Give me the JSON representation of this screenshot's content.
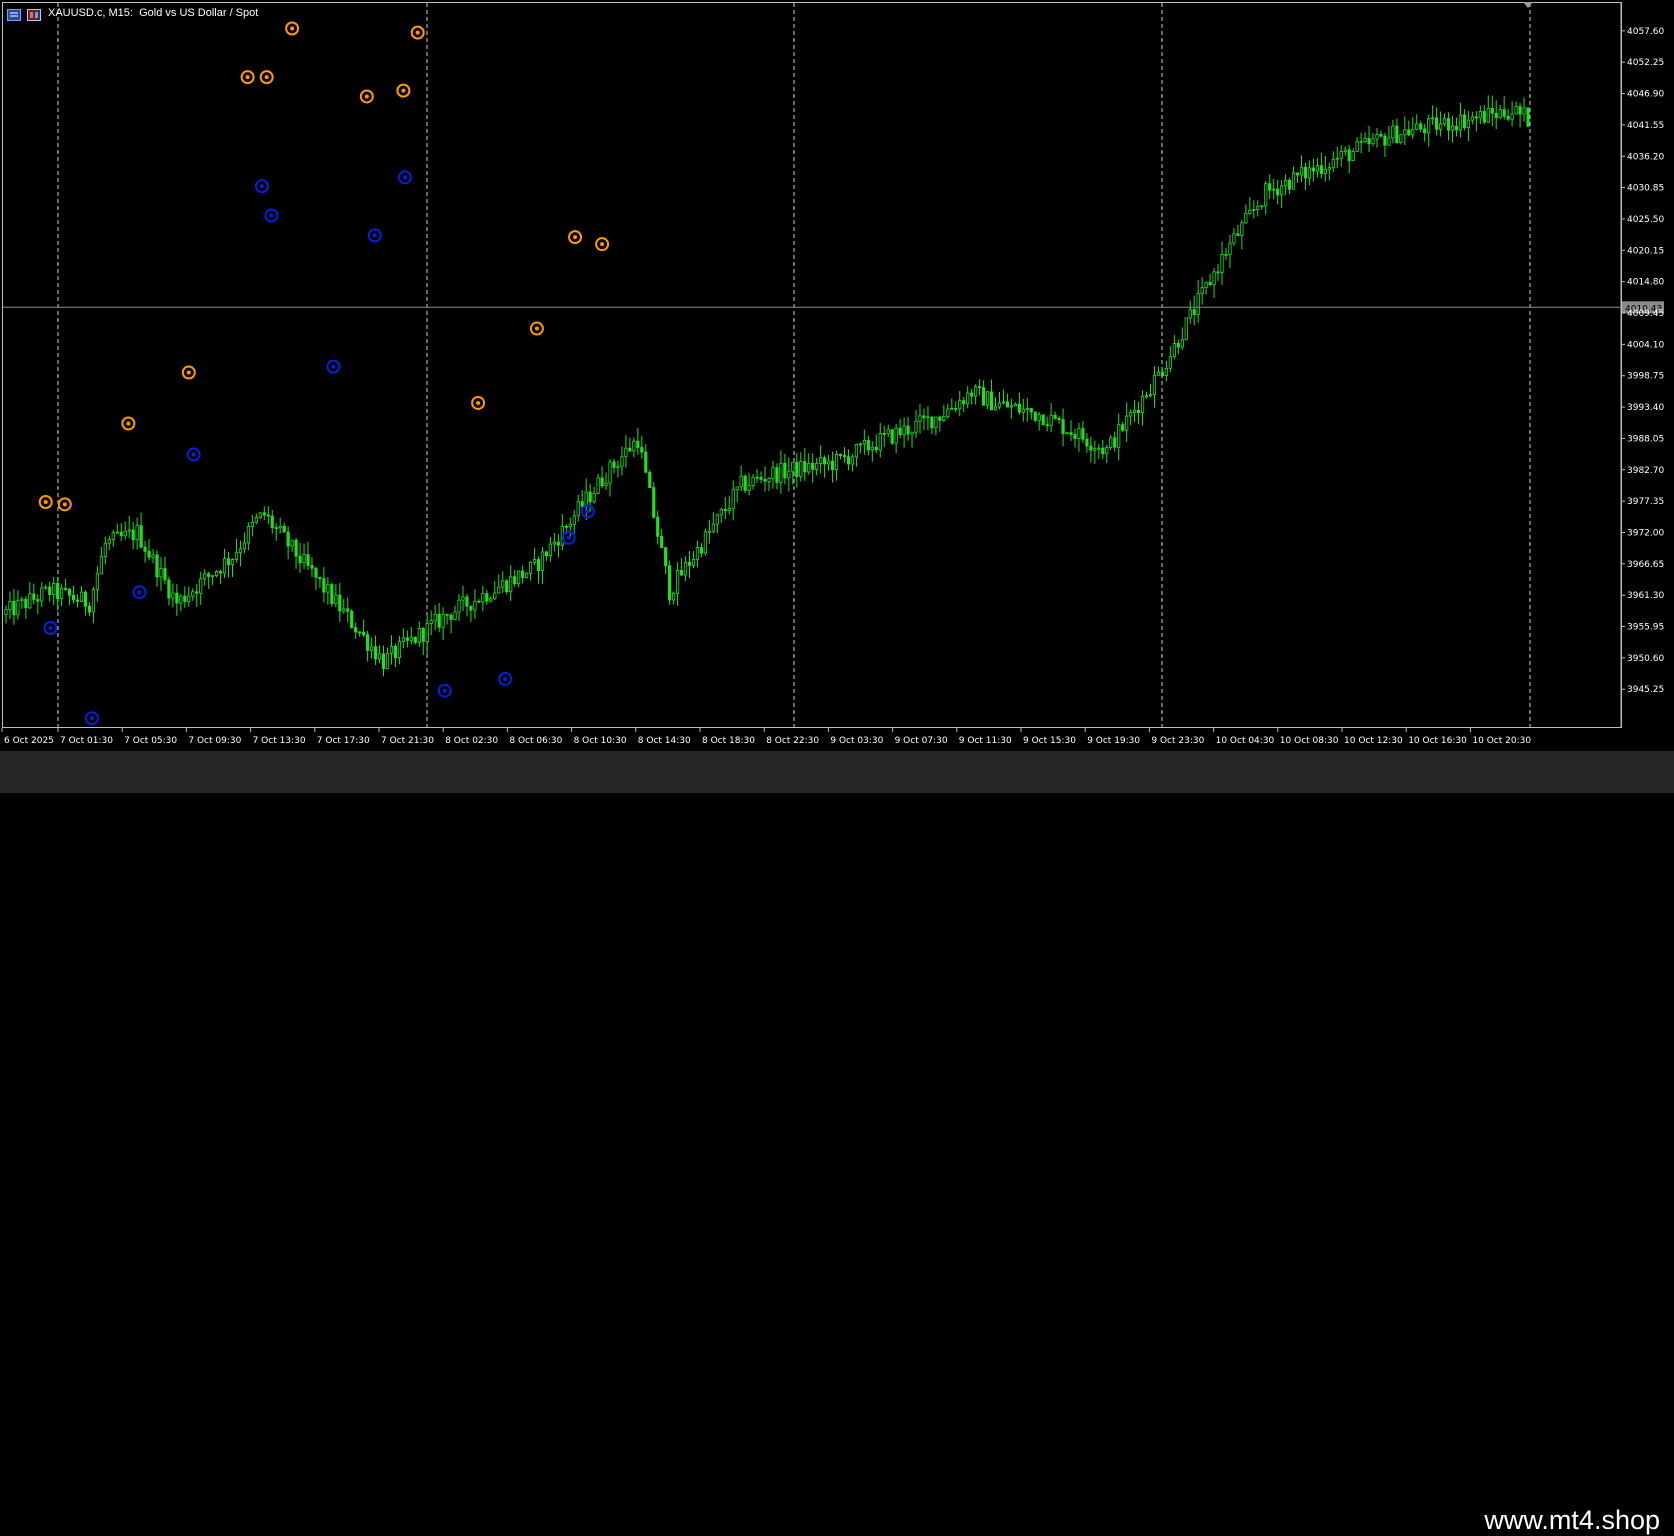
{
  "window": {
    "title_symbol": "XAUUSD.c, M15:",
    "title_desc": "Gold vs US Dollar / Spot",
    "icons": [
      "chart-menu-icon",
      "one-click-trading-icon"
    ]
  },
  "colors": {
    "background": "#000000",
    "candle": "#22dd22",
    "grid": "#cfcfcf",
    "axis_text": "#ffffff",
    "high_marker": "#ff9900",
    "low_marker": "#0022dd",
    "price_line": "#8a8a8a",
    "price_tag_bg": "#8a8a8a"
  },
  "chart_data": {
    "type": "candlestick",
    "symbol": "XAUUSD.c",
    "timeframe": "M15",
    "ylim": [
      3940.0,
      4061.5
    ],
    "y_ticks": [
      "4057.60",
      "4052.25",
      "4046.90",
      "4041.55",
      "4036.20",
      "4030.85",
      "4025.50",
      "4020.15",
      "4014.80",
      "4009.45",
      "4004.10",
      "3998.75",
      "3993.40",
      "3988.05",
      "3982.70",
      "3977.35",
      "3972.00",
      "3966.65",
      "3961.30",
      "3955.95",
      "3950.60",
      "3945.25"
    ],
    "x_ticks": [
      "6 Oct 2025",
      "7 Oct 01:30",
      "7 Oct 05:30",
      "7 Oct 09:30",
      "7 Oct 13:30",
      "7 Oct 17:30",
      "7 Oct 21:30",
      "8 Oct 02:30",
      "8 Oct 06:30",
      "8 Oct 10:30",
      "8 Oct 14:30",
      "8 Oct 18:30",
      "8 Oct 22:30",
      "9 Oct 03:30",
      "9 Oct 07:30",
      "9 Oct 11:30",
      "9 Oct 15:30",
      "9 Oct 19:30",
      "9 Oct 23:30",
      "10 Oct 04:30",
      "10 Oct 08:30",
      "10 Oct 12:30",
      "10 Oct 16:30",
      "10 Oct 20:30"
    ],
    "day_separators": [
      "7 Oct",
      "8 Oct",
      "9 Oct",
      "10 Oct",
      "13 Oct"
    ],
    "current_price": "4010.43",
    "bars": 384,
    "path": [
      [
        0,
        3958
      ],
      [
        12,
        3962
      ],
      [
        22,
        3960
      ],
      [
        26,
        3970
      ],
      [
        34,
        3972
      ],
      [
        44,
        3960
      ],
      [
        58,
        3968
      ],
      [
        64,
        3974
      ],
      [
        66,
        3975
      ],
      [
        78,
        3965
      ],
      [
        96,
        3950
      ],
      [
        112,
        3958
      ],
      [
        134,
        3966
      ],
      [
        152,
        3982
      ],
      [
        160,
        3988
      ],
      [
        168,
        3962
      ],
      [
        186,
        3980
      ],
      [
        194,
        3982
      ],
      [
        210,
        3984
      ],
      [
        222,
        3988
      ],
      [
        236,
        3992
      ],
      [
        244,
        3996
      ],
      [
        250,
        3994
      ],
      [
        262,
        3992
      ],
      [
        278,
        3986
      ],
      [
        292,
        4000
      ],
      [
        308,
        4020
      ],
      [
        318,
        4030
      ],
      [
        330,
        4034
      ],
      [
        350,
        4040
      ],
      [
        380,
        4044
      ],
      [
        398,
        4038
      ],
      [
        410,
        4035
      ],
      [
        420,
        4034
      ],
      [
        432,
        4042
      ],
      [
        448,
        4052
      ],
      [
        458,
        4052
      ],
      [
        476,
        4045
      ],
      [
        484,
        4044
      ],
      [
        504,
        4035
      ],
      [
        516,
        4020
      ],
      [
        534,
        4016
      ],
      [
        562,
        4014
      ],
      [
        570,
        4012
      ],
      [
        580,
        4006
      ],
      [
        596,
        4018
      ],
      [
        606,
        4028
      ],
      [
        622,
        4038
      ],
      [
        646,
        4040
      ],
      [
        664,
        4036
      ],
      [
        670,
        4026
      ],
      [
        686,
        4034
      ],
      [
        708,
        4040
      ],
      [
        726,
        4036
      ],
      [
        736,
        4040
      ],
      [
        744,
        4046
      ],
      [
        752,
        4056
      ],
      [
        760,
        4040
      ],
      [
        778,
        4032
      ],
      [
        792,
        4018
      ],
      [
        806,
        4012
      ],
      [
        818,
        4004
      ],
      [
        826,
        4004
      ],
      [
        834,
        3984
      ],
      [
        844,
        3958
      ],
      [
        852,
        3950
      ],
      [
        868,
        3972
      ],
      [
        884,
        3976
      ],
      [
        902,
        3980
      ],
      [
        922,
        3986
      ],
      [
        940,
        3990
      ],
      [
        948,
        3984
      ],
      [
        960,
        3980
      ],
      [
        968,
        3982
      ],
      [
        980,
        3970
      ],
      [
        998,
        3955
      ],
      [
        1006,
        3968
      ],
      [
        1018,
        3974
      ],
      [
        1038,
        3962
      ],
      [
        1050,
        3984
      ],
      [
        1066,
        3994
      ],
      [
        1086,
        4002
      ],
      [
        1098,
        3998
      ],
      [
        1104,
        3992
      ],
      [
        1120,
        3990
      ],
      [
        1136,
        3982
      ],
      [
        1144,
        3976
      ],
      [
        1154,
        3985
      ],
      [
        1172,
        4010
      ],
      [
        1180,
        4020
      ],
      [
        1188,
        4006
      ],
      [
        1196,
        3996
      ],
      [
        1204,
        3990
      ],
      [
        1216,
        3986
      ],
      [
        1226,
        3984
      ],
      [
        1234,
        3978
      ],
      [
        1242,
        3988
      ],
      [
        1252,
        3996
      ],
      [
        1262,
        4004
      ],
      [
        1268,
        4014
      ],
      [
        1276,
        4010
      ],
      [
        1284,
        4012
      ]
    ],
    "swing_highs": [
      [
        2.5,
        3977.2
      ],
      [
        3.7,
        3976.8
      ],
      [
        7.7,
        3990.6
      ],
      [
        11.5,
        3999.3
      ],
      [
        15.2,
        4049.7
      ],
      [
        16.4,
        4049.7
      ],
      [
        18.0,
        4058.0
      ],
      [
        22.7,
        4046.4
      ],
      [
        25.0,
        4047.4
      ],
      [
        25.9,
        4057.3
      ],
      [
        29.7,
        3994.1
      ],
      [
        33.4,
        4006.8
      ],
      [
        35.8,
        4022.4
      ],
      [
        37.5,
        4021.2
      ]
    ],
    "swing_lows": [
      [
        2.8,
        3955.7
      ],
      [
        5.4,
        3940.3
      ],
      [
        8.4,
        3961.8
      ],
      [
        11.8,
        3985.3
      ],
      [
        16.1,
        4031.1
      ],
      [
        16.7,
        4026.1
      ],
      [
        20.6,
        4000.3
      ],
      [
        23.2,
        4022.7
      ],
      [
        25.1,
        4032.6
      ],
      [
        27.6,
        3945.0
      ],
      [
        31.4,
        3947.0
      ],
      [
        35.4,
        3971.1
      ],
      [
        36.6,
        3975.6
      ]
    ]
  },
  "watermark": "www.mt4.shop"
}
